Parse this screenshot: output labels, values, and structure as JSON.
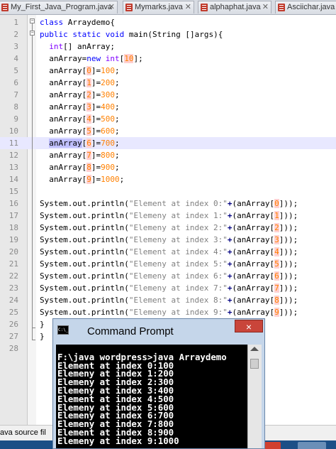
{
  "tabs": [
    {
      "label": "My_First_Java_Program.java"
    },
    {
      "label": "Mymarks.java"
    },
    {
      "label": "alphaphat.java"
    },
    {
      "label": "Asciichar.java"
    }
  ],
  "editor": {
    "current_line": 11,
    "lines": [
      {
        "n": "1",
        "t": "class Arraydemo{"
      },
      {
        "n": "2",
        "t": "public static void main(String []args){"
      },
      {
        "n": "3",
        "t": "  int[] anArray;"
      },
      {
        "n": "4",
        "t": "  anArray=new int[10];"
      },
      {
        "n": "5",
        "t": "  anArray[0]=100;"
      },
      {
        "n": "6",
        "t": "  anArray[1]=200;"
      },
      {
        "n": "7",
        "t": "  anArray[2]=300;"
      },
      {
        "n": "8",
        "t": "  anArray[3]=400;"
      },
      {
        "n": "9",
        "t": "  anArray[4]=500;"
      },
      {
        "n": "10",
        "t": "  anArray[5]=600;"
      },
      {
        "n": "11",
        "t": "  anArray[6]=700;"
      },
      {
        "n": "12",
        "t": "  anArray[7]=800;"
      },
      {
        "n": "13",
        "t": "  anArray[8]=900;"
      },
      {
        "n": "14",
        "t": "  anArray[9]=1000;"
      },
      {
        "n": "15",
        "t": ""
      },
      {
        "n": "16",
        "t": "System.out.println(\"Element at index 0:\"+(anArray[0]));"
      },
      {
        "n": "17",
        "t": "System.out.println(\"Elemeny at index 1:\"+(anArray[1]));"
      },
      {
        "n": "18",
        "t": "System.out.println(\"Elemeny at index 2:\"+(anArray[2]));"
      },
      {
        "n": "19",
        "t": "System.out.println(\"Elemeny at index 3:\"+(anArray[3]));"
      },
      {
        "n": "20",
        "t": "System.out.println(\"Element at index 4:\"+(anArray[4]));"
      },
      {
        "n": "21",
        "t": "System.out.println(\"Elemeny at index 5:\"+(anArray[5]));"
      },
      {
        "n": "22",
        "t": "System.out.println(\"Elemeny at index 6:\"+(anArray[6]));"
      },
      {
        "n": "23",
        "t": "System.out.println(\"Elemeny at index 7:\"+(anArray[7]));"
      },
      {
        "n": "24",
        "t": "System.out.println(\"Element at index 8:\"+(anArray[8]));"
      },
      {
        "n": "25",
        "t": "System.out.println(\"Elemeny at index 9:\"+(anArray[9]));"
      },
      {
        "n": "26",
        "t": "}"
      },
      {
        "n": "27",
        "t": "}"
      },
      {
        "n": "28",
        "t": ""
      }
    ]
  },
  "status": {
    "text": "ava source fil"
  },
  "cmd": {
    "title": "Command Prompt",
    "icon_text": "C:\\_",
    "close_label": "×",
    "lines": [
      "",
      "F:\\java wordpress>java Arraydemo",
      "Element at index 0:100",
      "Elemeny at index 1:200",
      "Elemeny at index 2:300",
      "Elemeny at index 3:400",
      "Element at index 4:500",
      "Elemeny at index 5:600",
      "Elemeny at index 6:700",
      "Elemeny at index 7:800",
      "Element at index 8:900",
      "Elemeny at index 9:1000"
    ]
  },
  "colors": {
    "keyword": "#0000ff",
    "type": "#8000ff",
    "number": "#ff8000",
    "string": "#808080",
    "current_line": "#e8e8ff",
    "taskbar": "#1c4f86"
  }
}
